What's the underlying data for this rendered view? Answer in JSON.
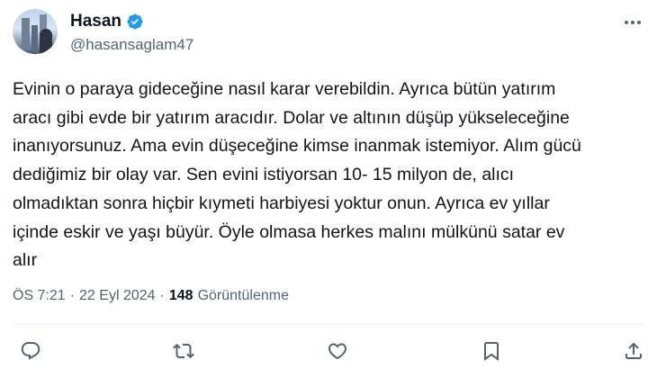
{
  "user": {
    "display_name": "Hasan",
    "handle": "@hasansaglam47",
    "verified": true
  },
  "tweet": {
    "text": "Evinin o paraya gideceğine nasıl karar verebildin. Ayrıca bütün yatırım\naracı gibi evde bir yatırım aracıdır. Dolar ve altının düşüp yükseleceğine\ninanıyorsunuz. Ama evin düşeceğine kimse inanmak istemiyor. Alım gücü\ndediğimiz bir olay var. Sen evini istiyorsan 10- 15 milyon de, alıcı\nolmadıktan sonra hiçbir kıymeti harbiyesi yoktur onun. Ayrıca ev yıllar\niçinde eskir ve yaşı büyür. Öyle olmasa herkes malını mülkünü satar ev\nalır"
  },
  "meta": {
    "time": "ÖS 7:21",
    "separator": "·",
    "date": "22 Eyl 2024",
    "views_count": "148",
    "views_label": "Görüntülenme"
  },
  "colors": {
    "accent": "#1d9bf0",
    "text": "#0f1419",
    "muted": "#536471"
  },
  "actions": [
    {
      "icon": "reply-icon"
    },
    {
      "icon": "retweet-icon"
    },
    {
      "icon": "like-icon"
    },
    {
      "icon": "bookmark-icon"
    },
    {
      "icon": "share-icon"
    }
  ]
}
